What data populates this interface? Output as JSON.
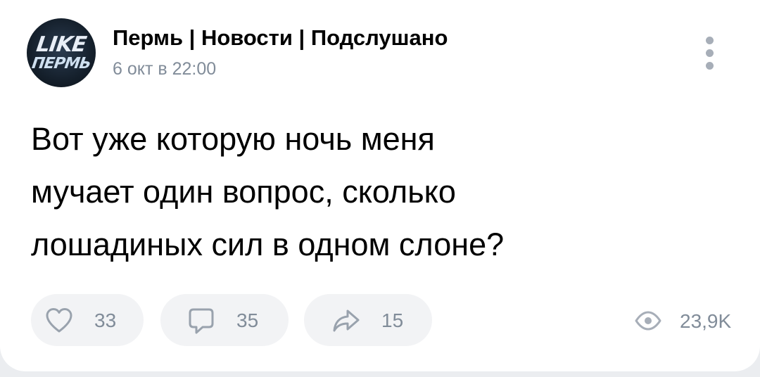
{
  "post": {
    "avatar": {
      "line1": "LIKE",
      "line2": "ПЕРМЬ"
    },
    "author": "Пермь | Новости | Подслушано",
    "date": "6 окт в 22:00",
    "text_lines": [
      "Вот уже которую ночь меня",
      "мучает один вопрос, сколько",
      "лошадиных сил в одном слоне?"
    ]
  },
  "actions": {
    "likes": "33",
    "comments": "35",
    "shares": "15",
    "views": "23,9K"
  },
  "colors": {
    "background": "#ebedf0",
    "card": "#ffffff",
    "secondary_text": "#818c99",
    "pill_background": "#f2f3f5"
  },
  "icons": {
    "like": "heart-icon",
    "comment": "comment-icon",
    "share": "share-icon",
    "views": "eye-icon",
    "more": "more-vertical-icon"
  }
}
